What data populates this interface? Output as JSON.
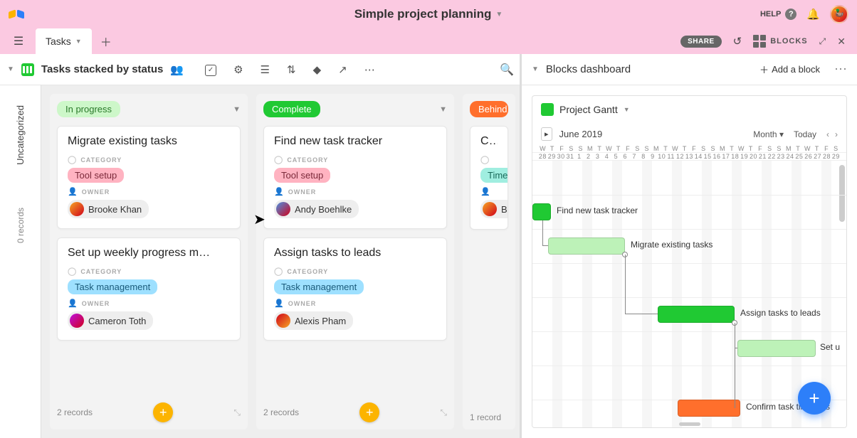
{
  "app": {
    "title": "Simple project planning",
    "help": "HELP"
  },
  "tab": {
    "name": "Tasks"
  },
  "right_tab": {
    "share": "SHARE",
    "blocks": "BLOCKS"
  },
  "view": {
    "name": "Tasks stacked by status"
  },
  "board": {
    "uncategorized": {
      "label": "Uncategorized",
      "count": "0 records"
    },
    "columns": [
      {
        "status": "In progress",
        "pill": "pill-yellow",
        "count": "2 records",
        "cards": [
          {
            "title": "Migrate existing tasks",
            "category_label": "CATEGORY",
            "category": "Tool setup",
            "cat_class": "tag-pink",
            "owner_label": "OWNER",
            "owner": "Brooke Khan",
            "av": "av1"
          },
          {
            "title": "Set up weekly progress m…",
            "category_label": "CATEGORY",
            "category": "Task management",
            "cat_class": "tag-blue",
            "owner_label": "OWNER",
            "owner": "Cameron Toth",
            "av": "av3"
          }
        ]
      },
      {
        "status": "Complete",
        "pill": "pill-green",
        "count": "2 records",
        "cards": [
          {
            "title": "Find new task tracker",
            "category_label": "CATEGORY",
            "category": "Tool setup",
            "cat_class": "tag-pink",
            "owner_label": "OWNER",
            "owner": "Andy Boehlke",
            "av": "av2"
          },
          {
            "title": "Assign tasks to leads",
            "category_label": "CATEGORY",
            "category": "Task management",
            "cat_class": "tag-blue",
            "owner_label": "OWNER",
            "owner": "Alexis Pham",
            "av": "av4"
          }
        ]
      },
      {
        "status": "Behind",
        "pill": "pill-orange",
        "count": "1 record",
        "partial": {
          "title": "Conf",
          "category": "Time",
          "owner_initial": "B"
        }
      }
    ]
  },
  "blocks": {
    "dashboard_title": "Blocks dashboard",
    "add_label": "Add a block",
    "block_name": "Project Gantt",
    "month": "June 2019",
    "zoom": "Month",
    "today": "Today",
    "dows": [
      "W",
      "T",
      "F",
      "S",
      "S",
      "M",
      "T",
      "W",
      "T",
      "F",
      "S",
      "S",
      "M",
      "T",
      "W",
      "T",
      "F",
      "S",
      "S",
      "M",
      "T",
      "W",
      "T",
      "F",
      "S",
      "S",
      "M",
      "T",
      "W",
      "T",
      "F",
      "S"
    ],
    "dnums": [
      "28",
      "29",
      "30",
      "31",
      "1",
      "2",
      "3",
      "4",
      "5",
      "6",
      "7",
      "8",
      "9",
      "10",
      "11",
      "12",
      "13",
      "14",
      "15",
      "16",
      "17",
      "18",
      "19",
      "20",
      "21",
      "22",
      "23",
      "24",
      "25",
      "26",
      "27",
      "28",
      "29"
    ],
    "bars": {
      "b1": "Find new task tracker",
      "b2": "Migrate existing tasks",
      "b3": "Assign tasks to leads",
      "b4": "Set u",
      "b5": "Confirm task timelines"
    }
  }
}
